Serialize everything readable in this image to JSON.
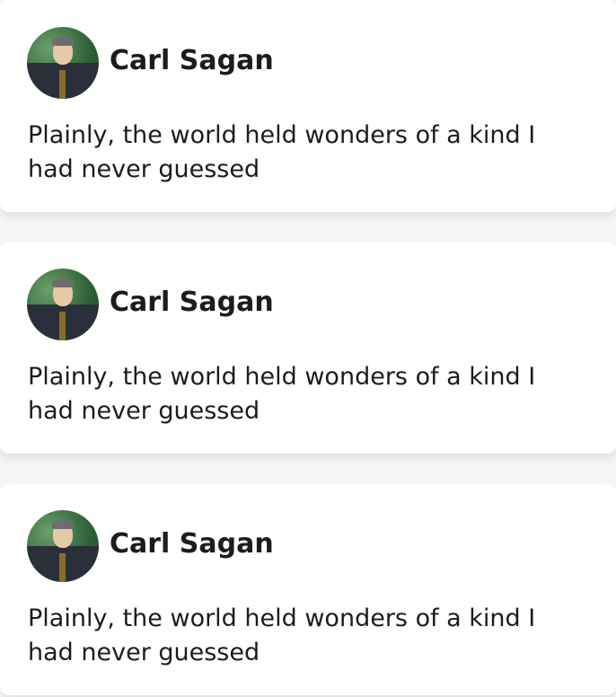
{
  "cards": [
    {
      "name": "Carl Sagan",
      "quote": "Plainly, the world held wonders of a kind I had never guessed"
    },
    {
      "name": "Carl Sagan",
      "quote": "Plainly, the world held wonders of a kind I had never guessed"
    },
    {
      "name": "Carl Sagan",
      "quote": "Plainly, the world held wonders of a kind I had never guessed"
    }
  ]
}
